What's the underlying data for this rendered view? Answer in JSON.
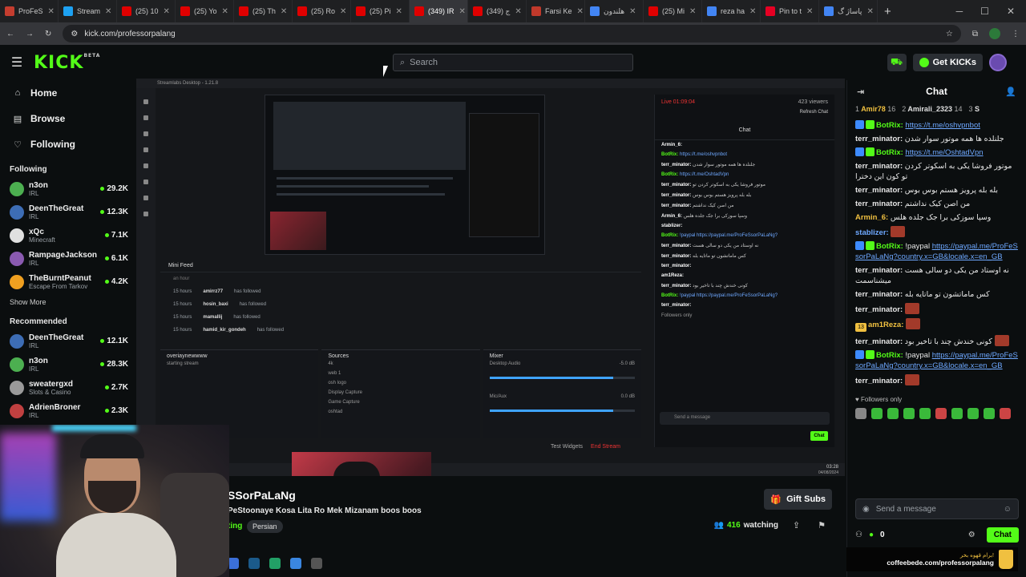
{
  "browser": {
    "tabs": [
      {
        "label": "ProFeS",
        "fav": "#c43d2f",
        "active": false
      },
      {
        "label": "Stream",
        "fav": "#1da1f2",
        "active": false
      },
      {
        "label": "(25) 10",
        "fav": "#e00000",
        "active": false
      },
      {
        "label": "(25) Yo",
        "fav": "#e00000",
        "active": false
      },
      {
        "label": "(25) Th",
        "fav": "#e00000",
        "active": false
      },
      {
        "label": "(25) Ro",
        "fav": "#e00000",
        "active": false
      },
      {
        "label": "(25) Pi",
        "fav": "#e00000",
        "active": false
      },
      {
        "label": "(349) IR",
        "fav": "#e00000",
        "active": true
      },
      {
        "label": "(349) ج",
        "fav": "#e00000",
        "active": false
      },
      {
        "label": "Farsi Ke",
        "fav": "#c0392b",
        "active": false
      },
      {
        "label": "هلندون",
        "fav": "#4285f4",
        "active": false
      },
      {
        "label": "(25) Mi",
        "fav": "#e00000",
        "active": false
      },
      {
        "label": "reza ha",
        "fav": "#4285f4",
        "active": false
      },
      {
        "label": "Pin to t",
        "fav": "#e60023",
        "active": false
      },
      {
        "label": "پاساژ گ",
        "fav": "#4285f4",
        "active": false
      }
    ],
    "url": "kick.com/professorpalang"
  },
  "header": {
    "logo": "KICK",
    "logo_sup": "BETA",
    "search_placeholder": "Search",
    "get_kicks_label": "Get KICKs"
  },
  "sidebar": {
    "nav": [
      {
        "label": "Home",
        "icon": "home-icon"
      },
      {
        "label": "Browse",
        "icon": "browse-icon"
      },
      {
        "label": "Following",
        "icon": "heart-icon"
      }
    ],
    "following_title": "Following",
    "following": [
      {
        "name": "n3on",
        "category": "IRL",
        "viewers": "29.2K",
        "color": "#4caf50"
      },
      {
        "name": "DeenTheGreat",
        "category": "IRL",
        "viewers": "12.3K",
        "color": "#3d6db5"
      },
      {
        "name": "xQc",
        "category": "Minecraft",
        "viewers": "7.1K",
        "color": "#e0e0e0"
      },
      {
        "name": "RampageJackson",
        "category": "IRL",
        "viewers": "6.1K",
        "color": "#8a5ab0"
      },
      {
        "name": "TheBurntPeanut",
        "category": "Escape From Tarkov",
        "viewers": "4.2K",
        "color": "#f0a020"
      }
    ],
    "show_more": "Show More",
    "recommended_title": "Recommended",
    "recommended": [
      {
        "name": "DeenTheGreat",
        "category": "IRL",
        "viewers": "12.1K",
        "color": "#3d6db5"
      },
      {
        "name": "n3on",
        "category": "IRL",
        "viewers": "28.3K",
        "color": "#4caf50"
      },
      {
        "name": "sweatergxd",
        "category": "Slots & Casino",
        "viewers": "2.7K",
        "color": "#9a9a9a"
      },
      {
        "name": "AdrienBroner",
        "category": "IRL",
        "viewers": "2.3K",
        "color": "#c04040"
      }
    ]
  },
  "player": {
    "app_title": "Streamlabs Desktop - 1.21.8",
    "live_time": "Live 01:09:04",
    "viewers": "423 viewers",
    "refresh_chat": "Refresh Chat",
    "inner_chat_title": "Chat",
    "inner_messages": [
      {
        "user": "Armin_6:",
        "text": ""
      },
      {
        "user": "BotRix:",
        "text": "https://t.me/oshvpnbot",
        "link": true
      },
      {
        "user": "terr_minator:",
        "text": "جلنلده ها همه موتور سوار شدن"
      },
      {
        "user": "BotRix:",
        "text": "https://t.me/OshtadVpn",
        "link": true
      },
      {
        "user": "terr_minator:",
        "text": "موتور فروشا یکی به اسکوتر کردن تو"
      },
      {
        "user": "terr_minator:",
        "text": "بله بله پرویز هستم بوس بوس"
      },
      {
        "user": "terr_minator:",
        "text": "من اصن کیک نداشتم"
      },
      {
        "user": "Armin_6:",
        "text": "وسپا سوزکی برا جک جلده هلس"
      },
      {
        "user": "stablizer:",
        "text": ""
      },
      {
        "user": "BotRix:",
        "text": "!paypal https://paypal.me/ProFeSsorPaLaNg?",
        "link": true
      },
      {
        "user": "terr_minator:",
        "text": "نه اوستاد من یکی دو سالی هست"
      },
      {
        "user": "terr_minator:",
        "text": "کس ماماتشون تو ماتایه بله"
      },
      {
        "user": "terr_minator:",
        "text": ""
      },
      {
        "user": "am1Reza:",
        "text": ""
      },
      {
        "user": "terr_minator:",
        "text": "کونی خندش چند با تاخیر بود"
      },
      {
        "user": "BotRix:",
        "text": "!paypal https://paypal.me/ProFeSsorPaLaNg?",
        "link": true
      },
      {
        "user": "terr_minator:",
        "text": ""
      }
    ],
    "followers_only": "Followers only",
    "send_placeholder": "Send a message",
    "chat_btn": "Chat",
    "mini_feed_title": "Mini Feed",
    "mini_feed_first": "an hour",
    "feed": [
      {
        "time": "15 hours",
        "user": "amirrz77",
        "action": "has followed"
      },
      {
        "time": "15 hours",
        "user": "hosin_baxi",
        "action": "has followed"
      },
      {
        "time": "15 hours",
        "user": "mamallij",
        "action": "has followed"
      },
      {
        "time": "15 hours",
        "user": "hamid_kir_gondeh",
        "action": "has followed"
      }
    ],
    "scene_title": "overiaynewwww",
    "scene_items": [
      "starting stream"
    ],
    "sources_title": "Sources",
    "sources": [
      "4k",
      "web 1",
      "osh logo",
      "Display Capture",
      "Game Capture",
      "oshtad"
    ],
    "mixer_title": "Mixer",
    "mixer": [
      {
        "name": "Desktop Audio",
        "db": "-5.0 dB"
      },
      {
        "name": "Mic/Aux",
        "db": "0.0 dB"
      }
    ],
    "test_widgets": "Test Widgets",
    "end_stream": "End Stream",
    "clock_time": "03:28",
    "clock_date": "04/08/2024"
  },
  "stream": {
    "streamer": "SSorPaLaNg",
    "title": "PeStoonaye Kosa Lita Ro Mek Mizanam boos boos",
    "category": "ting",
    "tag": "Persian",
    "gift_subs": "Gift Subs",
    "watching_count": "416",
    "watching_label": "watching"
  },
  "chat": {
    "title": "Chat",
    "gifters": [
      {
        "rank": "1",
        "name": "Amir78",
        "count": "16"
      },
      {
        "rank": "2",
        "name": "Amirali_2323",
        "count": "14"
      },
      {
        "rank": "3",
        "name": "S",
        "count": ""
      }
    ],
    "messages": [
      {
        "user": "BotRix:",
        "color": "#53fc18",
        "badges": [
          "#3d8bff",
          "#53fc18"
        ],
        "text": "https://t.me/oshvpnbot",
        "link": true
      },
      {
        "user": "terr_minator:",
        "color": "#e6e6e6",
        "badges": [],
        "text": "جلنلده ها همه موتور سوار شدن",
        "link": false
      },
      {
        "user": "BotRix:",
        "color": "#53fc18",
        "badges": [
          "#3d8bff",
          "#53fc18"
        ],
        "text": "https://t.me/OshtadVpn",
        "link": true
      },
      {
        "user": "terr_minator:",
        "color": "#e6e6e6",
        "badges": [],
        "text": "موتور فروشا یکی به اسکوتر کردن تو کون این دخترا",
        "link": false
      },
      {
        "user": "terr_minator:",
        "color": "#e6e6e6",
        "badges": [],
        "text": "بله بله پرویز هستم بوس بوس",
        "link": false
      },
      {
        "user": "terr_minator:",
        "color": "#e6e6e6",
        "badges": [],
        "text": "من اصن کیک نداشتم",
        "link": false
      },
      {
        "user": "Armin_6:",
        "color": "#f0c040",
        "badges": [],
        "text": "وسپا سوزکی برا جک جلده هلس",
        "link": false
      },
      {
        "user": "stablizer:",
        "color": "#6ea8ff",
        "badges": [],
        "text": "",
        "link": false,
        "emote": true
      },
      {
        "user": "BotRix:",
        "color": "#53fc18",
        "badges": [
          "#3d8bff",
          "#53fc18"
        ],
        "text": "!paypal ",
        "link": false,
        "link2": "https://paypal.me/ProFeSsorPaLaNg?country.x=GB&locale.x=en_GB"
      },
      {
        "user": "terr_minator:",
        "color": "#e6e6e6",
        "badges": [],
        "text": "نه اوستاد من یکی دو سالی هست میشناسمت",
        "link": false
      },
      {
        "user": "terr_minator:",
        "color": "#e6e6e6",
        "badges": [],
        "text": "کس ماماتشون تو ماتایه بله",
        "link": false
      },
      {
        "user": "terr_minator:",
        "color": "#e6e6e6",
        "badges": [],
        "text": "",
        "link": false,
        "emote": true
      },
      {
        "user": "am1Reza:",
        "color": "#f0c040",
        "badges": [
          "#f0c040"
        ],
        "badge_text": "13",
        "text": "",
        "link": false,
        "emote": true
      },
      {
        "user": "terr_minator:",
        "color": "#e6e6e6",
        "badges": [],
        "text": "کونی خندش چند با تاخیر بود",
        "link": false,
        "emote": true
      },
      {
        "user": "BotRix:",
        "color": "#53fc18",
        "badges": [
          "#3d8bff",
          "#53fc18"
        ],
        "text": "!paypal ",
        "link": false,
        "link2": "https://paypal.me/ProFeSsorPaLaNg?country.x=GB&locale.x=en_GB"
      },
      {
        "user": "terr_minator:",
        "color": "#e6e6e6",
        "badges": [],
        "text": "",
        "link": false,
        "emote": true
      }
    ],
    "followers_only": "Followers only",
    "send_placeholder": "Send a message",
    "kicks_count": "0",
    "chat_btn": "Chat"
  },
  "coffee": {
    "farsi": "برام قهوه بخر!",
    "url": "coffeebede.com/professorpalang"
  }
}
